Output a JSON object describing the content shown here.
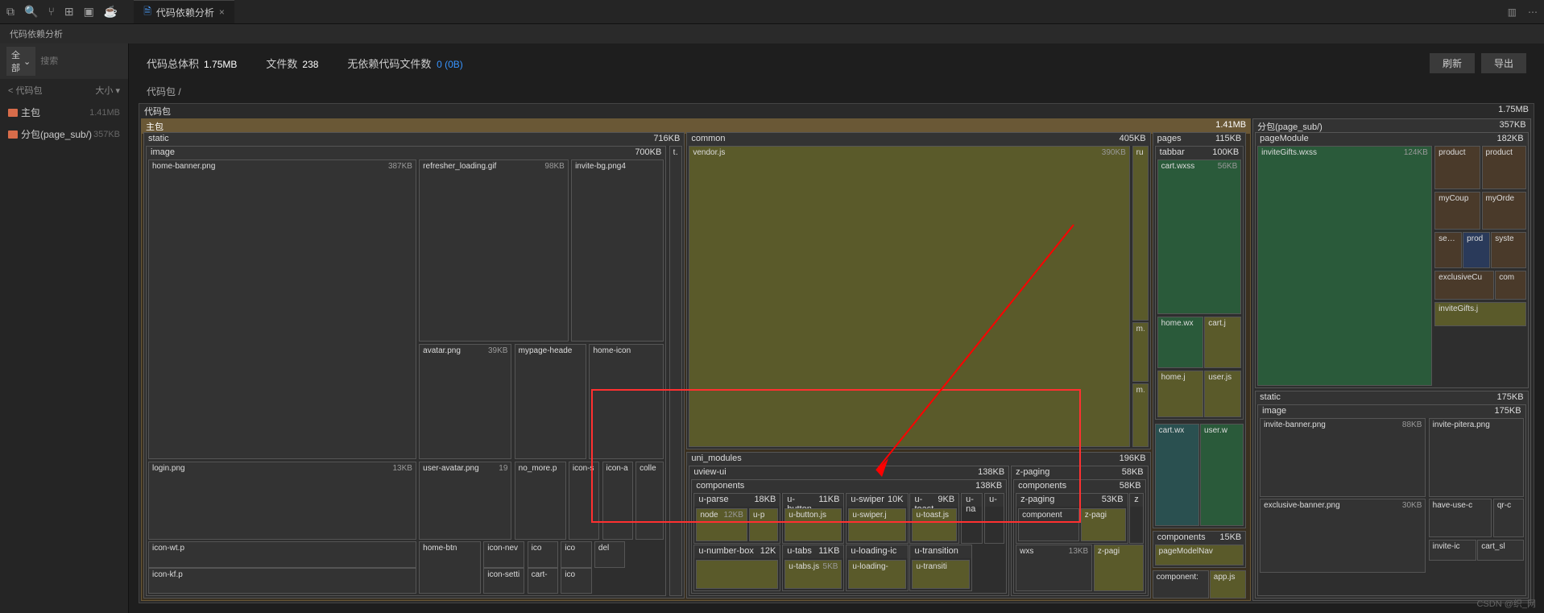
{
  "titlebar": {
    "tab_title": "代码依赖分析",
    "close": "×"
  },
  "subbar": {
    "title": "代码依赖分析"
  },
  "sidebar": {
    "filter_all": "全部",
    "search_placeholder": "搜索",
    "head_name": "< 代码包",
    "head_size": "大小",
    "items": [
      {
        "name": "主包",
        "size": "1.41MB"
      },
      {
        "name": "分包(page_sub/)",
        "size": "357KB"
      }
    ]
  },
  "stats": {
    "total_label": "代码总体积",
    "total_val": "1.75MB",
    "files_label": "文件数",
    "files_val": "238",
    "nodep_label": "无依赖代码文件数",
    "nodep_val": "0 (0B)",
    "refresh": "刷新",
    "export": "导出"
  },
  "breadcrumb": "代码包 /",
  "root": {
    "name": "代码包",
    "size": "1.75MB"
  },
  "mainpack": {
    "name": "主包",
    "size": "1.41MB"
  },
  "static": {
    "name": "static",
    "size": "716KB"
  },
  "image": {
    "name": "image",
    "size": "700KB"
  },
  "home_banner": {
    "name": "home-banner.png",
    "size": "387KB"
  },
  "refresher": {
    "name": "refresher_loading.gif",
    "size": "98KB"
  },
  "invite_bg": {
    "name": "invite-bg.png4"
  },
  "avatar": {
    "name": "avatar.png",
    "size": "39KB"
  },
  "mypage_header": {
    "name": "mypage-heade"
  },
  "home_icon": {
    "name": "home-icon"
  },
  "user_avatar": {
    "name": "user-avatar.png",
    "size": "19"
  },
  "no_more": {
    "name": "no_more.p"
  },
  "icon_s": {
    "name": "icon-s"
  },
  "icon_a": {
    "name": "icon-a"
  },
  "collec": {
    "name": "colle"
  },
  "login": {
    "name": "login.png",
    "size": "13KB"
  },
  "home_btn": {
    "name": "home-btn"
  },
  "icon_nev": {
    "name": "icon-nev"
  },
  "icon_sett": {
    "name": "icon-setti"
  },
  "icon_wt": {
    "name": "icon-wt.p"
  },
  "icon_kf": {
    "name": "icon-kf.p"
  },
  "ico1": {
    "name": "ico"
  },
  "ico2": {
    "name": "ico"
  },
  "ico3": {
    "name": "ico"
  },
  "del": {
    "name": "del"
  },
  "cart_ico": {
    "name": "cart-"
  },
  "ta": {
    "name": "ta"
  },
  "common": {
    "name": "common",
    "size": "405KB"
  },
  "vendor": {
    "name": "vendor.js",
    "size": "390KB"
  },
  "ru": {
    "name": "ru"
  },
  "ma1": {
    "name": "ma"
  },
  "ma2": {
    "name": "ma"
  },
  "uni_modules": {
    "name": "uni_modules",
    "size": "196KB"
  },
  "uview": {
    "name": "uview-ui",
    "size": "138KB"
  },
  "uv_comp": {
    "name": "components",
    "size": "138KB"
  },
  "u_parse": {
    "name": "u-parse",
    "size": "18KB"
  },
  "node": {
    "name": "node",
    "size": "12KB"
  },
  "u_p": {
    "name": "u-p"
  },
  "u_number": {
    "name": "u-number-box",
    "size": "12K"
  },
  "u_button": {
    "name": "u-button",
    "size": "11KB"
  },
  "u_button_js": {
    "name": "u-button.js"
  },
  "u_tabs": {
    "name": "u-tabs",
    "size": "11KB"
  },
  "u_tabs_js": {
    "name": "u-tabs.js",
    "size": "5KB"
  },
  "u_swiper": {
    "name": "u-swiper",
    "size": "10K"
  },
  "u_swiper_js": {
    "name": "u-swiper.j"
  },
  "u_loading": {
    "name": "u-loading-ic"
  },
  "u_loading2": {
    "name": "u-loading-"
  },
  "u_toast": {
    "name": "u-toast",
    "size": "9KB"
  },
  "u_toast_js": {
    "name": "u-toast.js"
  },
  "u_transition": {
    "name": "u-transition"
  },
  "u_transition2": {
    "name": "u-transiti"
  },
  "u_na": {
    "name": "u-na"
  },
  "u_dash": {
    "name": "u-"
  },
  "z_paging": {
    "name": "z-paging",
    "size": "58KB"
  },
  "z_comp": {
    "name": "components",
    "size": "58KB"
  },
  "z_paging2": {
    "name": "z-paging",
    "size": "53KB"
  },
  "z_component": {
    "name": "component"
  },
  "z_pagi": {
    "name": "z-pagi"
  },
  "z_pagi2": {
    "name": "z-pagi"
  },
  "z": {
    "name": "z"
  },
  "wxs": {
    "name": "wxs",
    "size": "13KB"
  },
  "pages": {
    "name": "pages",
    "size": "115KB"
  },
  "tabbar": {
    "name": "tabbar",
    "size": "100KB"
  },
  "cart_wxss": {
    "name": "cart.wxss",
    "size": "56KB"
  },
  "home_wx": {
    "name": "home.wx"
  },
  "cart_j": {
    "name": "cart.j"
  },
  "home_j": {
    "name": "home.j"
  },
  "user_js": {
    "name": "user.js"
  },
  "cart_wx2": {
    "name": "cart.wx"
  },
  "user_w": {
    "name": "user.w"
  },
  "components2": {
    "name": "components",
    "size": "15KB"
  },
  "pageModelNav": {
    "name": "pageModelNav"
  },
  "components3": {
    "name": "component:"
  },
  "app_js": {
    "name": "app.js"
  },
  "subpack": {
    "name": "分包(page_sub/)",
    "size": "357KB"
  },
  "pageModule": {
    "name": "pageModule",
    "size": "182KB"
  },
  "inviteGifts": {
    "name": "inviteGifts.wxss",
    "size": "124KB"
  },
  "product": {
    "name": "product"
  },
  "product2": {
    "name": "product"
  },
  "myCoup": {
    "name": "myCoup"
  },
  "myOrde": {
    "name": "myOrde"
  },
  "setti": {
    "name": "settin"
  },
  "prod": {
    "name": "prod"
  },
  "syste": {
    "name": "syste"
  },
  "exclusiveC": {
    "name": "exclusiveCu"
  },
  "com": {
    "name": "com"
  },
  "inviteGifts_j": {
    "name": "inviteGifts.j"
  },
  "sub_static": {
    "name": "static",
    "size": "175KB"
  },
  "sub_image": {
    "name": "image",
    "size": "175KB"
  },
  "invite_banner": {
    "name": "invite-banner.png",
    "size": "88KB"
  },
  "invite_pitera": {
    "name": "invite-pitera.png"
  },
  "have_use": {
    "name": "have-use-c"
  },
  "qr_c": {
    "name": "qr-c"
  },
  "exclusive_banner": {
    "name": "exclusive-banner.png",
    "size": "30KB"
  },
  "invite_ic": {
    "name": "invite-ic"
  },
  "cart_sl": {
    "name": "cart_sl"
  },
  "watermark": "CSDN @织_网"
}
